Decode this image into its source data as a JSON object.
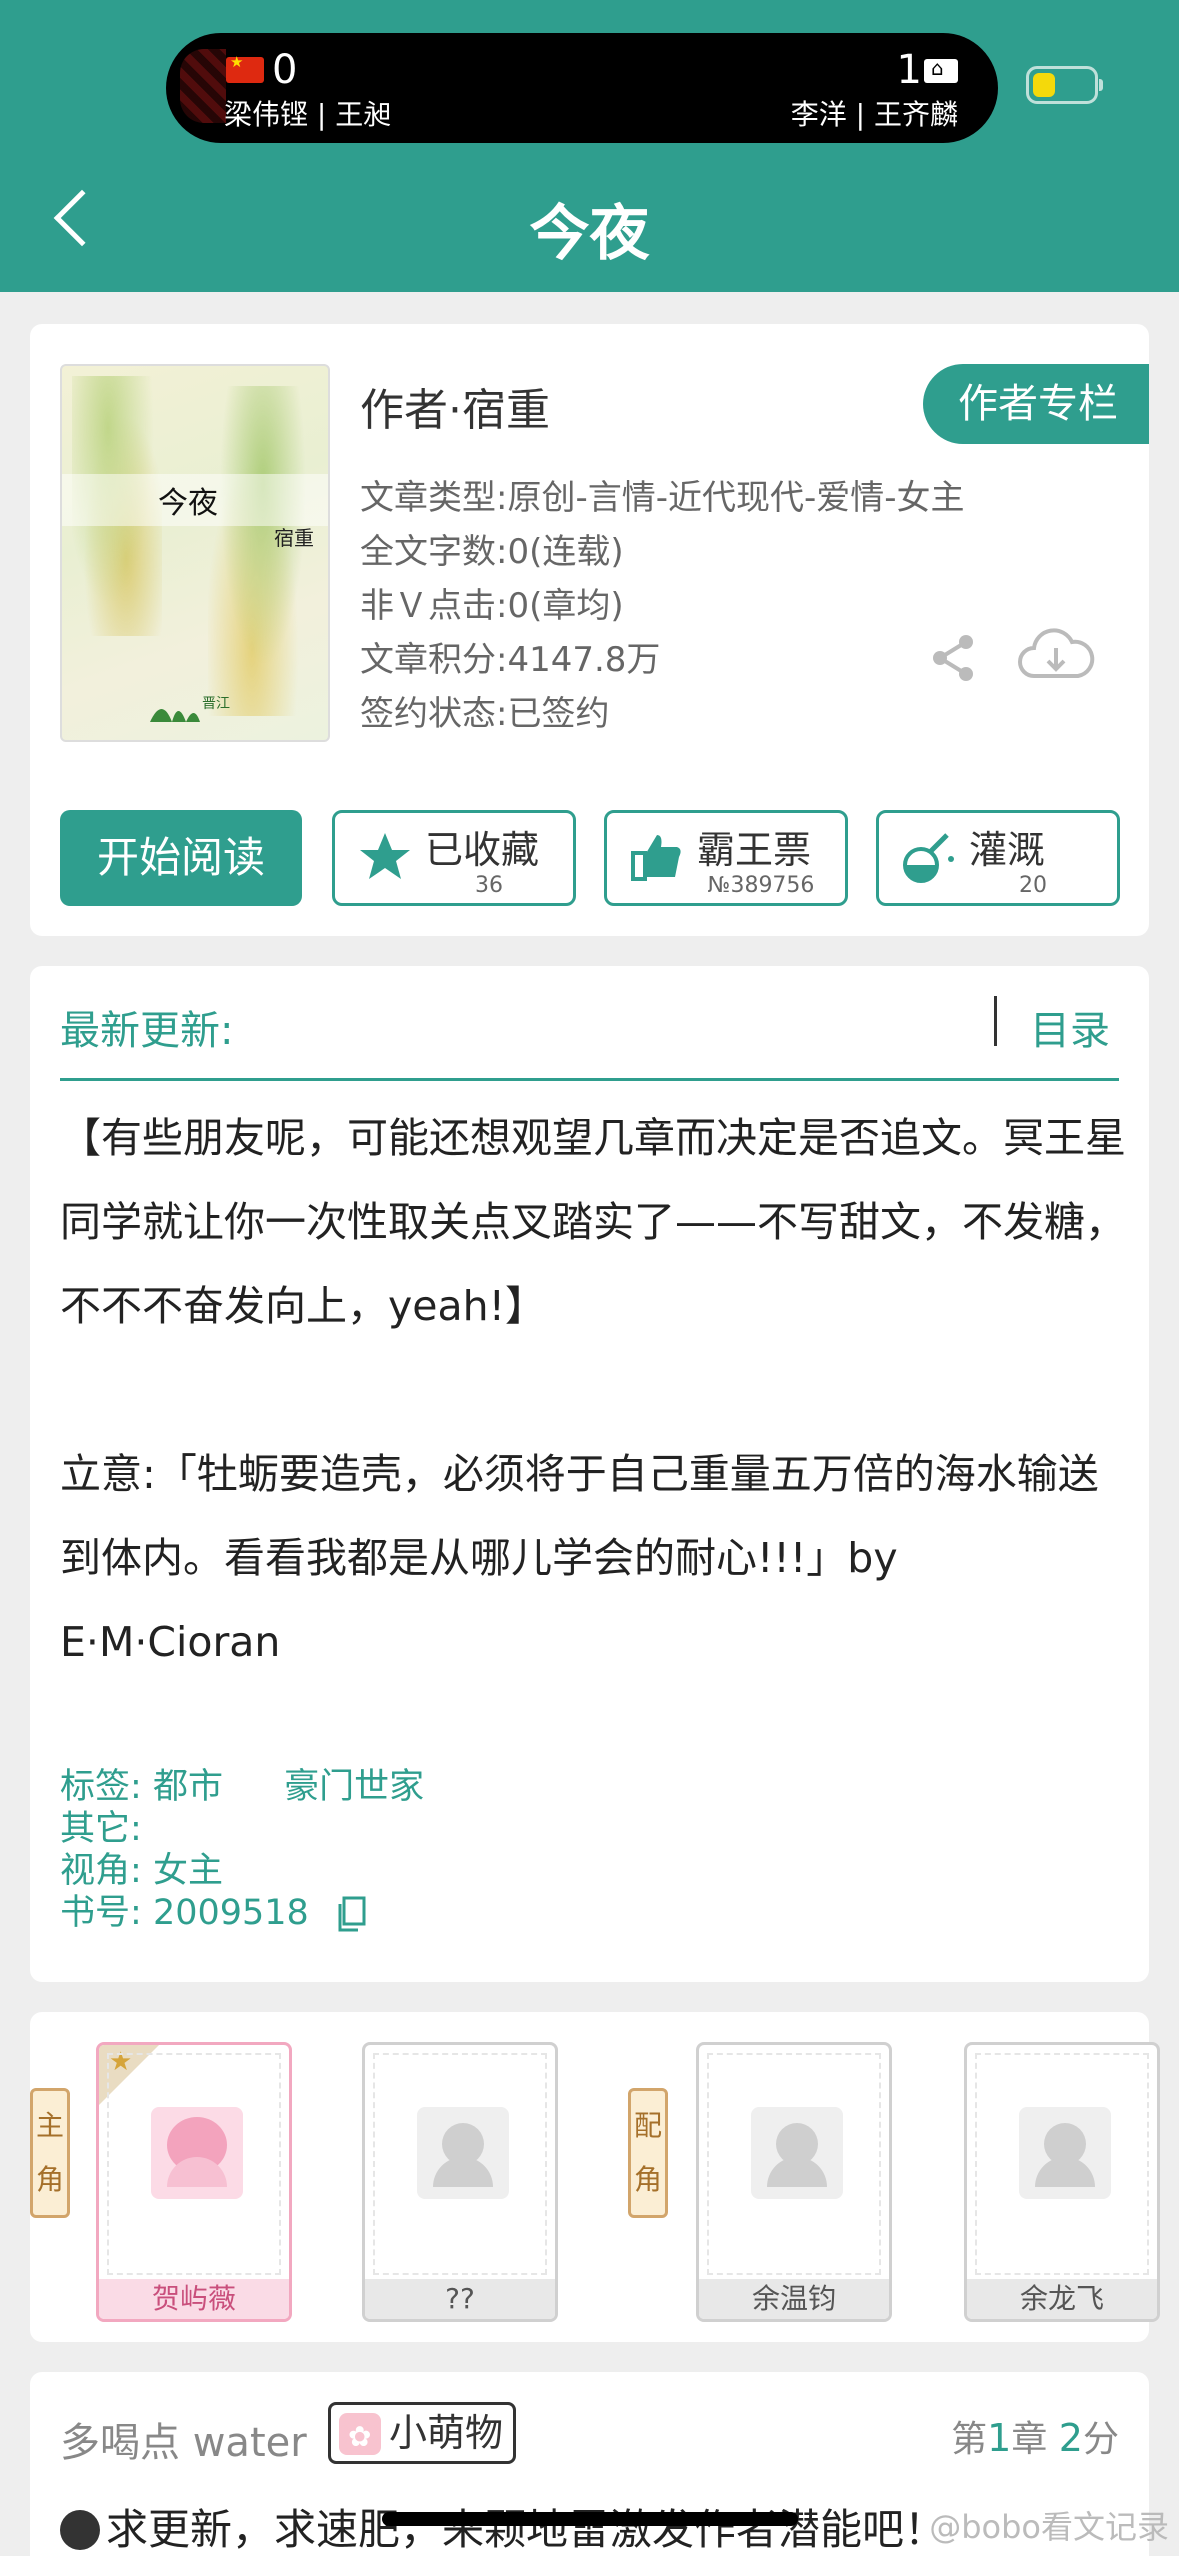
{
  "status_bar": {
    "left_score": "0",
    "right_score": "1",
    "left_players": "梁伟铿 | 王昶",
    "right_players": "李洋 | 王齐麟"
  },
  "nav": {
    "title": "今夜"
  },
  "book": {
    "cover_title": "今夜",
    "cover_author": "宿重",
    "author": "作者·宿重",
    "author_column": "作者专栏",
    "type": "文章类型:原创-言情-近代现代-爱情-女主",
    "word_count": "全文字数:0(连载)",
    "clicks": "非Ｖ点击:0(章均)",
    "score": "文章积分:4147.8万",
    "contract": "签约状态:已签约"
  },
  "actions": {
    "read": "开始阅读",
    "collect_label": "已收藏",
    "collect_count": "36",
    "bawang_label": "霸王票",
    "bawang_rank": "№389756",
    "water_label": "灌溉",
    "water_count": "20"
  },
  "latest": {
    "label": "最新更新:",
    "toc": "目录",
    "intro_1": "【有些朋友呢，可能还想观望几章而决定是否追文。冥王星同学就让你一次性取关点叉踏实了——不写甜文，不发糖，不不不奋发向上，yeah!】",
    "intro_2": "立意:「牡蛎要造壳，必须将于自己重量五万倍的海水输送到体内。看看我都是从哪儿学会的耐心!!!」by E·M·Cioran",
    "tags_label": "标签:",
    "tag_1": "都市",
    "tag_2": "豪门世家",
    "other_label": "其它:",
    "view_label": "视角:",
    "view_value": "女主",
    "book_no_label": "书号:",
    "book_no": "2009518"
  },
  "characters": {
    "main_label": "主角",
    "support_label": "配角",
    "list": [
      {
        "name": "贺屿薇"
      },
      {
        "name": "??"
      },
      {
        "name": "余温钧"
      },
      {
        "name": "余龙飞"
      }
    ]
  },
  "comment": {
    "user": "多喝点 water",
    "badge": "小萌物",
    "chapter_prefix": "第",
    "chapter_num": "1",
    "chapter_mid": "章",
    "score_num": "2",
    "score_suffix": "分",
    "text": "求更新，求速肥，来颗地雷激发作者潜能吧！"
  },
  "watermark": "@bobo看文记录",
  "colors": {
    "accent": "#2f9e8e"
  },
  "icons": [
    "back-chevron-icon",
    "share-icon",
    "download-cloud-icon",
    "star-icon",
    "thumbs-up-icon",
    "watering-can-icon",
    "copy-icon",
    "bomb-icon"
  ]
}
